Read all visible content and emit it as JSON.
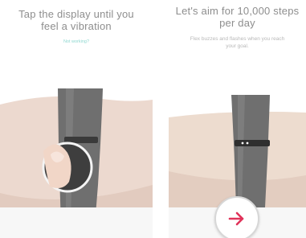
{
  "left_screen": {
    "headline_line1": "Tap the display until you",
    "headline_line2": "feel a vibration",
    "link_label": "Not working?"
  },
  "right_screen": {
    "headline_line1": "Let's aim for 10,000 steps",
    "headline_line2": "per day",
    "subtext_line1": "Flex buzzes and flashes when you reach",
    "subtext_line2": "your goal.",
    "next_button_icon": "arrow-right-icon"
  },
  "colors": {
    "headline": "#8e8e8e",
    "link": "#8fd8d0",
    "subtext": "#b8b8b8",
    "band": "#6f6f6f",
    "accent_arrow": "#e0335a"
  }
}
